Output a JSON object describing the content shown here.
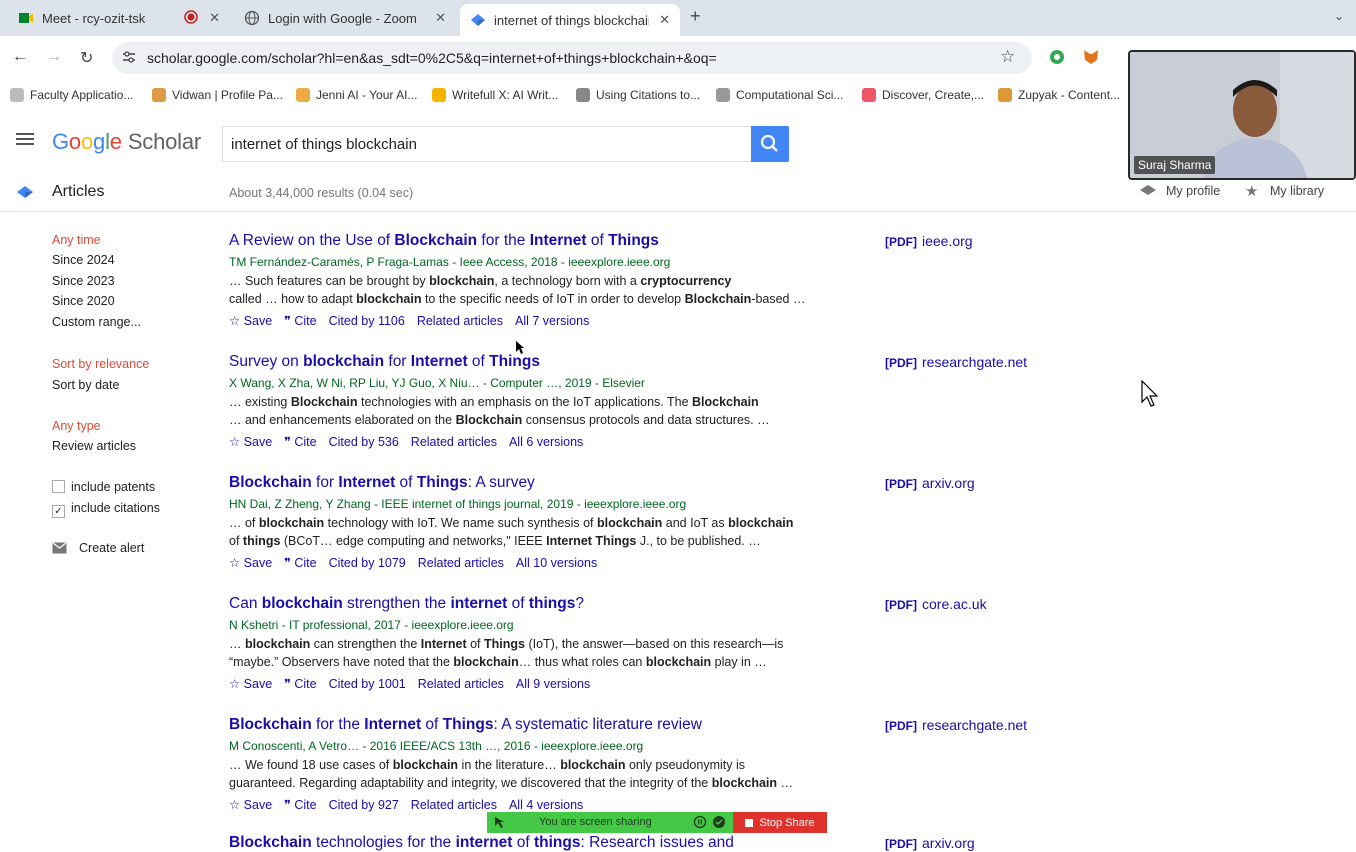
{
  "tabs": [
    {
      "title": "Meet - rcy-ozit-tsk",
      "active": false
    },
    {
      "title": "Login with Google - Zoom",
      "active": false
    },
    {
      "title": "internet of things blockchain",
      "active": true
    }
  ],
  "new_tab_symbol": "+",
  "address": "scholar.google.com/scholar?hl=en&as_sdt=0%2C5&q=internet+of+things+blockchain+&oq=",
  "bookmarks": [
    "Faculty Applicatio...",
    "Vidwan | Profile Pa...",
    "Jenni AI - Your AI...",
    "Writefull X: AI Writ...",
    "Using Citations to...",
    "Computational Sci...",
    "Discover, Create,...",
    "Zupyak - Content..."
  ],
  "scholar": {
    "logo_google": [
      "G",
      "o",
      "o",
      "g",
      "l",
      "e"
    ],
    "logo_scholar": "Scholar",
    "query": "internet of things blockchain",
    "section": "Articles",
    "results_count": "About 3,44,000 results (0.04 sec)",
    "my_profile": "My profile",
    "my_library": "My library"
  },
  "sidebar": {
    "time_header": "Any time",
    "time_options": [
      "Since 2024",
      "Since 2023",
      "Since 2020",
      "Custom range..."
    ],
    "sort_header": "Sort by relevance",
    "sort_option": "Sort by date",
    "type_header": "Any type",
    "type_option": "Review articles",
    "include_patents": "include patents",
    "include_citations": "include citations",
    "create_alert": "Create alert"
  },
  "results": [
    {
      "title": "A Review on the Use of Blockchain for the Internet of Things",
      "authors": "TM Fernández-Caramés, P Fraga-Lamas - Ieee Access, 2018 - ieeexplore.ieee.org",
      "snippet1": "… Such features can be brought by blockchain, a technology born with a cryptocurrency",
      "snippet2": "called … how to adapt blockchain to the specific needs of IoT in order to develop Blockchain-based …",
      "cited": "Cited by 1106",
      "versions": "All 7 versions",
      "pdf_site": "ieee.org"
    },
    {
      "title": "Survey on blockchain for Internet of Things",
      "authors": "X Wang, X Zha, W Ni, RP Liu, YJ Guo, X Niu… - Computer …, 2019 - Elsevier",
      "snippet1": "… existing Blockchain technologies with an emphasis on the IoT applications. The Blockchain",
      "snippet2": "… and enhancements elaborated on the Blockchain consensus protocols and data structures. …",
      "cited": "Cited by 536",
      "versions": "All 6 versions",
      "pdf_site": "researchgate.net"
    },
    {
      "title": "Blockchain for Internet of Things: A survey",
      "authors": "HN Dai, Z Zheng, Y Zhang - IEEE internet of things journal, 2019 - ieeexplore.ieee.org",
      "snippet1": "… of blockchain technology with IoT. We name such synthesis of blockchain and IoT as blockchain",
      "snippet2": "of things (BCoT… edge computing and networks,\" IEEE Internet Things J., to be published. …",
      "cited": "Cited by 1079",
      "versions": "All 10 versions",
      "pdf_site": "arxiv.org"
    },
    {
      "title": "Can blockchain strengthen the internet of things?",
      "authors": "N Kshetri - IT professional, 2017 - ieeexplore.ieee.org",
      "snippet1": "… blockchain can strengthen the Internet of Things (IoT), the answer—based on this research—is",
      "snippet2": "“maybe.” Observers have noted that the blockchain… thus what roles can blockchain play in …",
      "cited": "Cited by 1001",
      "versions": "All 9 versions",
      "pdf_site": "core.ac.uk"
    },
    {
      "title": "Blockchain for the Internet of Things: A systematic literature review",
      "authors": "M Conoscenti, A Vetro… - 2016 IEEE/ACS 13th …, 2016 - ieeexplore.ieee.org",
      "snippet1": "… We found 18 use cases of blockchain in the literature… blockchain only pseudonymity is",
      "snippet2": "guaranteed. Regarding adaptability and integrity, we discovered that the integrity of the blockchain …",
      "cited": "Cited by 927",
      "versions": "All 4 versions",
      "pdf_site": "researchgate.net"
    },
    {
      "title": "Blockchain technologies for the internet of things: Research issues and",
      "pdf_site": "arxiv.org"
    }
  ],
  "actions": {
    "save": "Save",
    "cite": "Cite",
    "related": "Related articles",
    "pdf_tag": "[PDF]"
  },
  "video": {
    "name": "Suraj Sharma"
  },
  "share_bar": {
    "status": "You are screen sharing",
    "stop": "Stop Share"
  },
  "colors": {
    "link": "#1a0dab",
    "green": "#006621",
    "red": "#dd4b39",
    "search_btn": "#4285f4"
  }
}
